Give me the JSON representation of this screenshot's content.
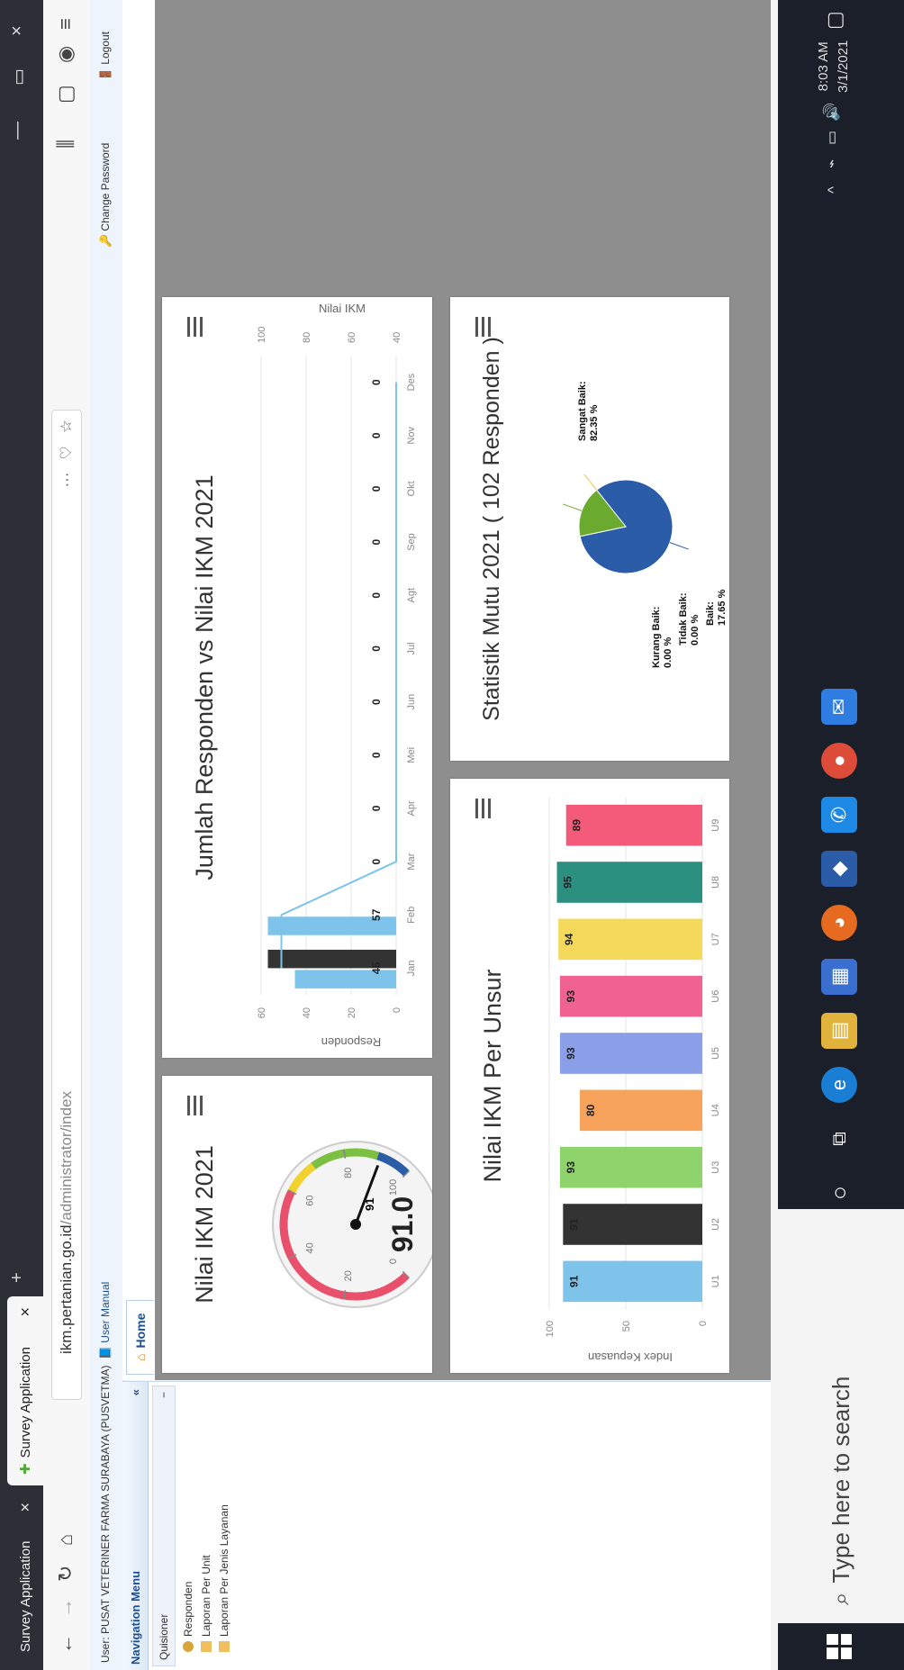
{
  "browser": {
    "tabs": [
      {
        "label": "Survey Application",
        "close": "×"
      },
      {
        "label": "Survey Application",
        "close": "×"
      }
    ],
    "new_tab": "+",
    "window": {
      "minimize": "—",
      "restore": "▭",
      "close": "×"
    },
    "url_host": "ikm.pertanian.go.id",
    "url_path": "/administrator/index",
    "more": "···"
  },
  "app": {
    "user_label": "User: PUSAT VETERINER FARMA SURABAYA (PUSVETMA)",
    "user_manual": "User Manual",
    "change_password": "Change Password",
    "logout": "Logout"
  },
  "nav": {
    "title": "Navigation Menu",
    "collapse": "«",
    "group": "Quisioner",
    "group_toggle": "−",
    "items": [
      "Responden",
      "Laporan Per Unit",
      "Laporan Per Jenis Layanan"
    ]
  },
  "content": {
    "tab_home": "Home"
  },
  "gauge": {
    "title": "Nilai IKM 2021",
    "value": 91,
    "value_display": "91.0",
    "needle_label": "91",
    "ticks": [
      "0",
      "20",
      "40",
      "60",
      "80",
      "100"
    ]
  },
  "combo": {
    "title": "Jumlah Responden vs Nilai IKM 2021",
    "y_left_label": "Responden",
    "y_right_label": "Nilai IKM",
    "y_left_ticks": [
      "0",
      "20",
      "40",
      "60"
    ],
    "y_right_ticks": [
      "40",
      "60",
      "80",
      "100"
    ],
    "value_labels": [
      "45",
      "57",
      "0",
      "0",
      "0",
      "0",
      "0",
      "0",
      "0",
      "0",
      "0",
      "0"
    ]
  },
  "unsur": {
    "title": "Nilai IKM Per Unsur",
    "y_label": "Index Kepuasan",
    "y_ticks": [
      "0",
      "50",
      "100"
    ]
  },
  "pie": {
    "title": "Statistik Mutu 2021 ( 102 Responden )",
    "labels": [
      {
        "name": "Sangat Baik:",
        "pct": "82.35 %"
      },
      {
        "name": "Baik:",
        "pct": "17.65 %"
      },
      {
        "name": "Tidak Baik:",
        "pct": "0.00 %"
      },
      {
        "name": "Kurang Baik:",
        "pct": "0.00 %"
      }
    ]
  },
  "taskbar": {
    "search_placeholder": "Type here to search",
    "time": "8:03 AM",
    "date": "3/1/2021"
  },
  "colors": {
    "gauge_red": "#e8506b",
    "gauge_yellow": "#f2d22e",
    "gauge_green": "#7bc043",
    "gauge_blue": "#2a5ca8",
    "pie_blue": "#2a5ca8",
    "pie_green": "#6aaa2e"
  },
  "chart_data": [
    {
      "type": "bar",
      "title": "Jumlah Responden vs Nilai IKM 2021",
      "categories": [
        "Jan",
        "Feb",
        "Mar",
        "Apr",
        "Mei",
        "Jun",
        "Jul",
        "Agt",
        "Sep",
        "Okt",
        "Nov",
        "Des"
      ],
      "series": [
        {
          "values": [
            45,
            57,
            0,
            0,
            0,
            0,
            0,
            0,
            0,
            0,
            0,
            0
          ],
          "color": "#7ec3ea",
          "kind": "bar"
        },
        {
          "values": [
            57,
            0,
            0,
            0,
            0,
            0,
            0,
            0,
            0,
            0,
            0,
            0
          ],
          "color": "#333333",
          "kind": "bar"
        },
        {
          "values": [
            91,
            91,
            0,
            0,
            0,
            0,
            0,
            0,
            0,
            0,
            0,
            0
          ],
          "color": "#7ec3ea",
          "kind": "line",
          "axis": "right"
        }
      ],
      "ylabel": "Responden",
      "ylim": [
        0,
        60
      ],
      "y2label": "Nilai IKM",
      "y2lim": [
        40,
        100
      ]
    },
    {
      "type": "bar",
      "title": "Nilai IKM Per Unsur",
      "categories": [
        "U1",
        "U2",
        "U3",
        "U4",
        "U5",
        "U6",
        "U7",
        "U8",
        "U9"
      ],
      "values": [
        91,
        91,
        93,
        80,
        93,
        93,
        94,
        95,
        89
      ],
      "colors": [
        "#7ec3ea",
        "#333333",
        "#8ed36b",
        "#f7a35c",
        "#8b9fe8",
        "#f06292",
        "#f5d95a",
        "#2b9080",
        "#f45b7a"
      ],
      "ylabel": "Index Kepuasan",
      "ylim": [
        0,
        100
      ]
    },
    {
      "type": "pie",
      "title": "Statistik Mutu 2021 ( 102 Responden )",
      "categories": [
        "Sangat Baik",
        "Baik",
        "Tidak Baik",
        "Kurang Baik"
      ],
      "values": [
        82.35,
        17.65,
        0.0,
        0.0
      ],
      "colors": [
        "#2a5ca8",
        "#6aaa2e",
        "#f06292",
        "#f5d95a"
      ]
    }
  ]
}
